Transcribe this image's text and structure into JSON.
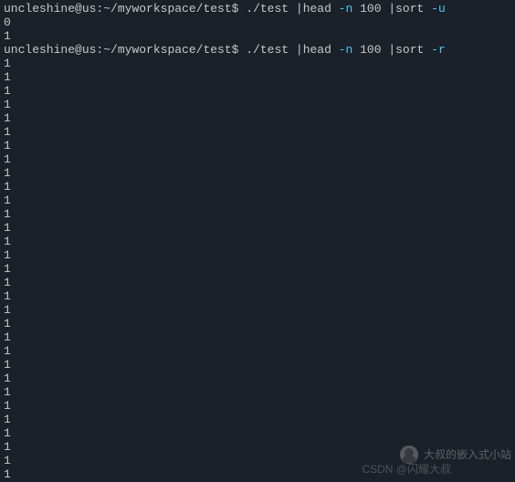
{
  "prompt1": {
    "user_host": "uncleshine@us",
    "colon": ":",
    "path": "~/myworkspace/test",
    "dollar": "$ ",
    "cmd_part1": "./test |head ",
    "flag1": "-n",
    "cmd_part2": " 100 |sort ",
    "flag2": "-u"
  },
  "output1": [
    "0",
    "1"
  ],
  "prompt2": {
    "user_host": "uncleshine@us",
    "colon": ":",
    "path": "~/myworkspace/test",
    "dollar": "$ ",
    "cmd_part1": "./test |head ",
    "flag1": "-n",
    "cmd_part2": " 100 |sort ",
    "flag2": "-r"
  },
  "output2": [
    "1",
    "1",
    "1",
    "1",
    "1",
    "1",
    "1",
    "1",
    "1",
    "1",
    "1",
    "1",
    "1",
    "1",
    "1",
    "1",
    "1",
    "1",
    "1",
    "1",
    "1",
    "1",
    "1",
    "1",
    "1",
    "1",
    "1",
    "1",
    "1",
    "1",
    "1"
  ],
  "watermark": {
    "qr_label": "大叔的嵌入式小站",
    "csdn_label": "CSDN @闪耀大叔"
  }
}
